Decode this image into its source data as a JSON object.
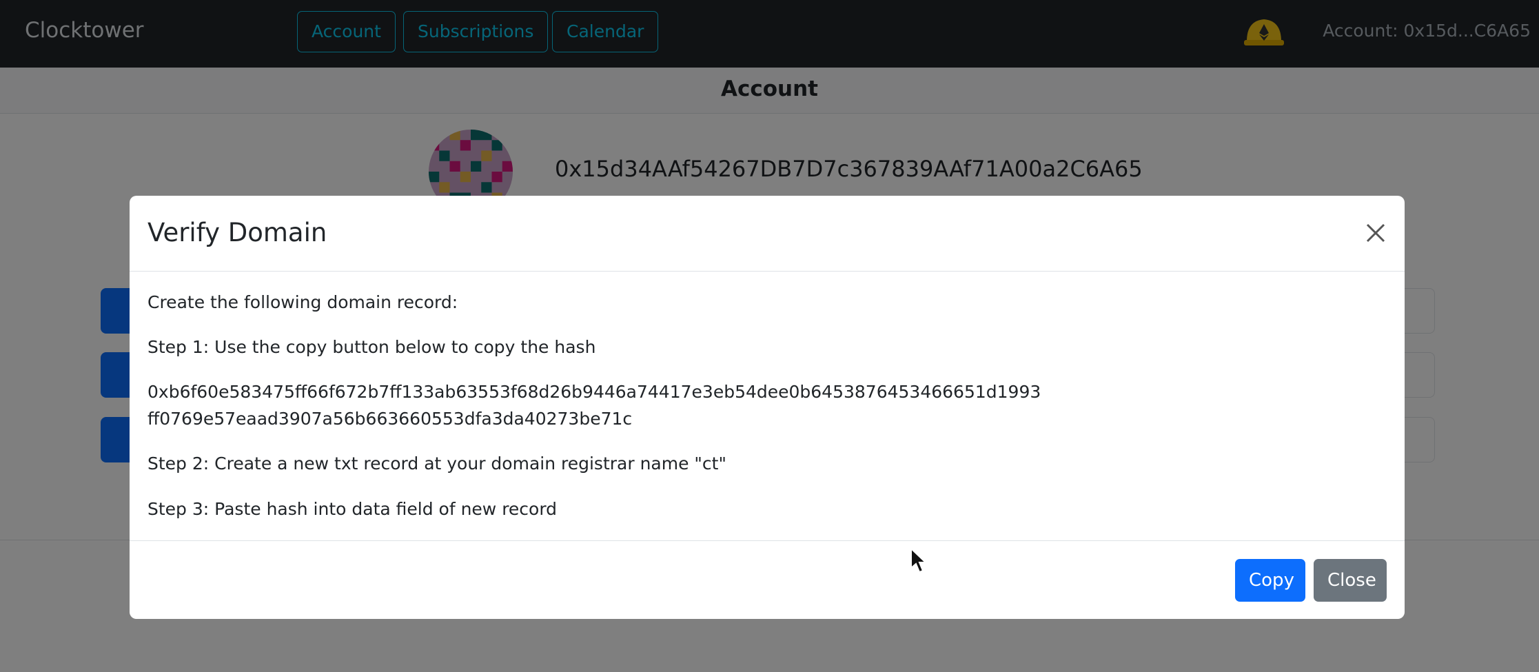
{
  "navbar": {
    "brand": "Clocktower",
    "links": [
      {
        "label": "Account"
      },
      {
        "label": "Subscriptions"
      },
      {
        "label": "Calendar"
      }
    ],
    "account_label": "Account: 0x15d...C6A65"
  },
  "page": {
    "title": "Account",
    "address": "0x15d34AAf54267DB7D7c367839AAf71A00a2C6A65"
  },
  "modal": {
    "title": "Verify Domain",
    "intro": "Create the following domain record:",
    "step1": "Step 1: Use the copy button below to copy the hash",
    "hash_line1": "0xb6f60e583475ff66f672b7ff133ab63553f68d26b9446a74417e3eb54dee0b6453876453466651d1993",
    "hash_line2": "ff0769e57eaad3907a56b663660553dfa3da40273be71c",
    "step2": "Step 2: Create a new txt record at your domain registrar name \"ct\"",
    "step3": "Step 3: Paste hash into data field of new record",
    "copy_label": "Copy",
    "close_label": "Close"
  },
  "colors": {
    "navbar_bg": "#212529",
    "nav_accent": "#0dcaf0",
    "primary": "#0d6efd",
    "secondary": "#6c757d",
    "helmet": "#f5c518"
  },
  "icons": {
    "close": "close-icon",
    "helmet": "ethereum-helmet-icon",
    "avatar": "identicon-avatar",
    "cursor": "mouse-cursor-icon"
  }
}
